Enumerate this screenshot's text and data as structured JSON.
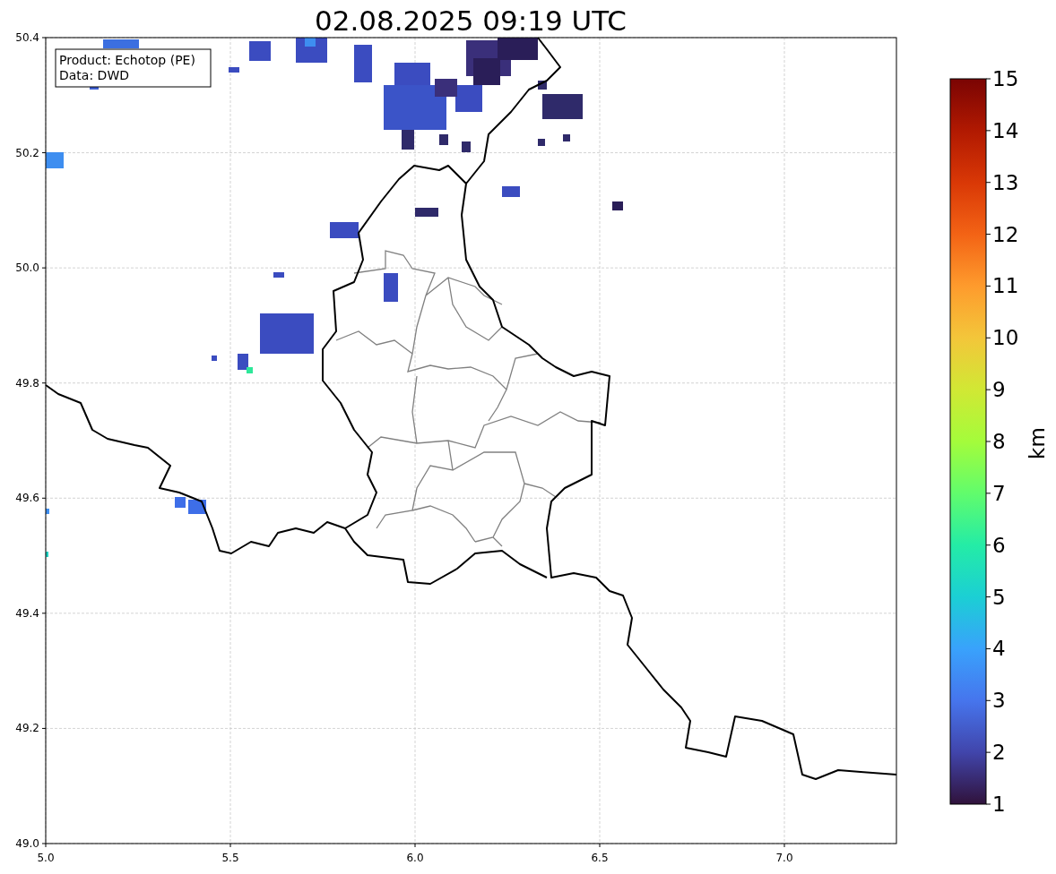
{
  "title": "02.08.2025 09:19 UTC",
  "legend": [
    "Product: Echotop (PE)",
    "Data: DWD"
  ],
  "x_ticks": [
    "5.0",
    "5.5",
    "6.0",
    "6.5",
    "7.0"
  ],
  "y_ticks": [
    "50.4",
    "50.2",
    "50.0",
    "49.8",
    "49.6",
    "49.4",
    "49.2",
    "49.0"
  ],
  "colorbar": {
    "label": "km",
    "ticks": [
      "15",
      "14",
      "13",
      "12",
      "11",
      "10",
      "9",
      "8",
      "7",
      "6",
      "5",
      "4",
      "3",
      "2",
      "1"
    ]
  }
}
